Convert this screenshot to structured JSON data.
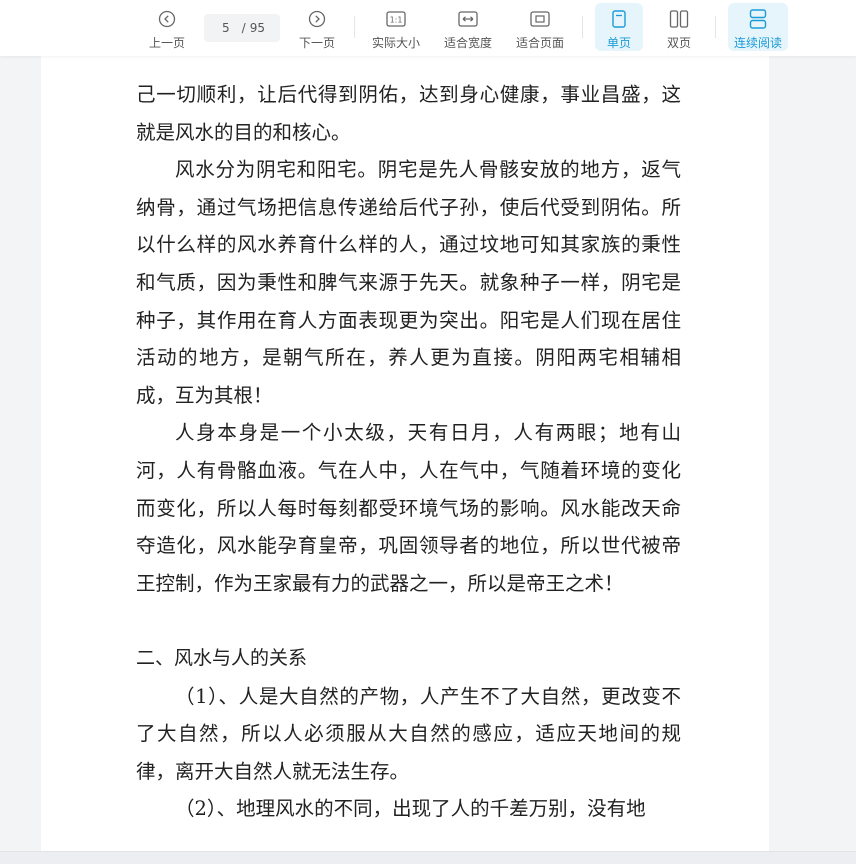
{
  "toolbar": {
    "prev_label": "上一页",
    "next_label": "下一页",
    "current_page": "5",
    "page_separator": "/",
    "total_pages": "95",
    "actual_size_label": "实际大小",
    "fit_width_label": "适合宽度",
    "fit_page_label": "适合页面",
    "single_page_label": "单页",
    "double_page_label": "双页",
    "continuous_label": "连续阅读",
    "active_color": "#1a9bd7"
  },
  "document": {
    "paragraphs": [
      "己一切顺利，让后代得到阴佑，达到身心健康，事业昌盛，这就是风水的目的和核心。",
      "风水分为阴宅和阳宅。阴宅是先人骨骸安放的地方，返气纳骨，通过气场把信息传递给后代子孙，使后代受到阴佑。所以什么样的风水养育什么样的人，通过坟地可知其家族的秉性和气质，因为秉性和脾气来源于先天。就象种子一样，阴宅是种子，其作用在育人方面表现更为突出。阳宅是人们现在居住活动的地方，是朝气所在，养人更为直接。阴阳两宅相辅相成，互为其根！",
      "人身本身是一个小太级，天有日月，人有两眼；地有山河，人有骨骼血液。气在人中，人在气中，气随着环境的变化而变化，所以人每时每刻都受环境气场的影响。风水能改天命夺造化，风水能孕育皇帝，巩固领导者的地位，所以世代被帝王控制，作为王家最有力的武器之一，所以是帝王之术！"
    ],
    "heading": "二、风水与人的关系",
    "paragraphs2": [
      "（1）、人是大自然的产物，人产生不了大自然，更改变不了大自然，所以人必须服从大自然的感应，适应天地间的规律，离开大自然人就无法生存。",
      "（2）、地理风水的不同，出现了人的千差万别，没有地"
    ]
  }
}
